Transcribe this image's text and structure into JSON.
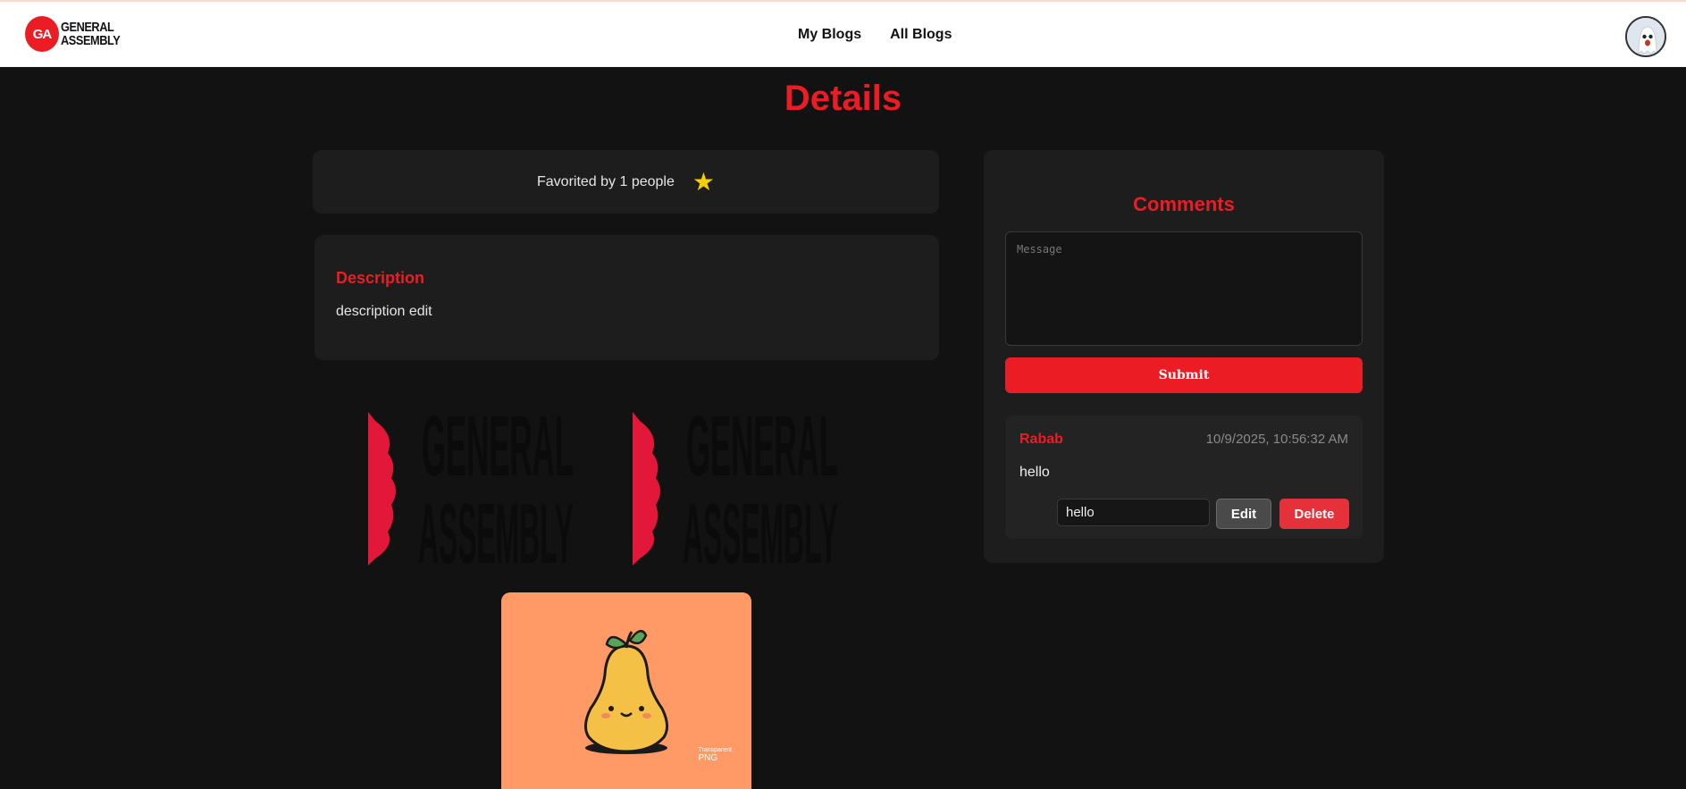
{
  "header": {
    "logo_badge": "GA",
    "logo_line1": "GENERAL",
    "logo_line2": "ASSEMBLY",
    "nav": [
      "My Blogs",
      "All Blogs"
    ]
  },
  "page": {
    "title": "Details"
  },
  "favorites": {
    "text": "Favorited by 1 people",
    "icon": "star-icon",
    "icon_color": "#f5d000"
  },
  "description": {
    "heading": "Description",
    "text": "description edit"
  },
  "images": {
    "logo_image": {
      "line1": "GENERAL",
      "line2": "ASSEMBLY",
      "accent": "#ec1c24"
    },
    "pear_image": {
      "label_small": "Transparent",
      "label_big": "PNG",
      "background": "#ff9966"
    }
  },
  "comments": {
    "heading": "Comments",
    "placeholder": "Message",
    "submit_label": "Submit",
    "items": [
      {
        "author": "Rabab",
        "timestamp": "10/9/2025, 10:56:32 AM",
        "body": "hello",
        "edit_value": "hello",
        "edit_label": "Edit",
        "delete_label": "Delete"
      }
    ]
  },
  "colors": {
    "accent": "#ec1c24",
    "background": "#121212",
    "card": "#1d1d1d"
  }
}
